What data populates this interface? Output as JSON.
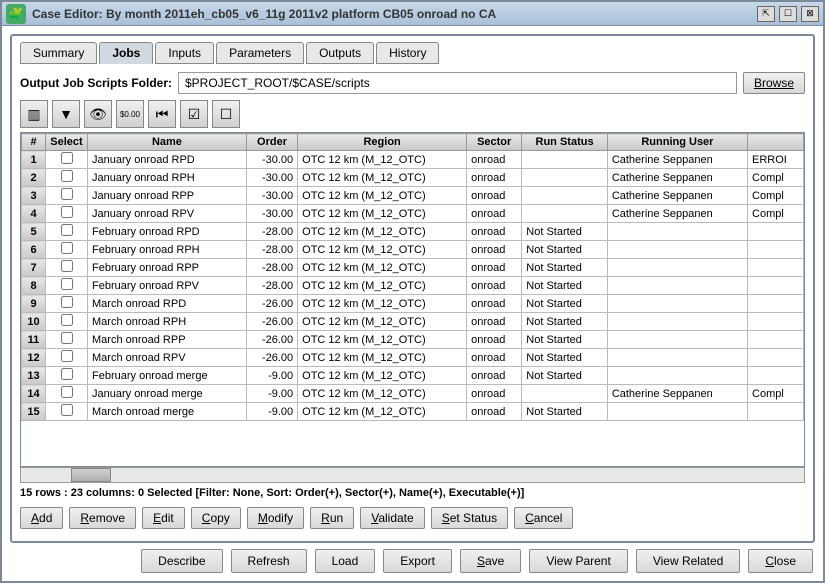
{
  "title": "Case Editor: By month 2011eh_cb05_v6_11g 2011v2 platform CB05 onroad no CA",
  "tabs": [
    "Summary",
    "Jobs",
    "Inputs",
    "Parameters",
    "Outputs",
    "History"
  ],
  "activeTab": 1,
  "folderLabel": "Output Job Scripts Folder:",
  "folderValue": "$PROJECT_ROOT/$CASE/scripts",
  "browseLabel": "Browse",
  "columns": [
    "#",
    "Select",
    "Name",
    "Order",
    "Region",
    "Sector",
    "Run Status",
    "Running User",
    ""
  ],
  "rows": [
    {
      "n": 1,
      "name": "January onroad RPD",
      "order": "-30.00",
      "region": "OTC 12 km (M_12_OTC)",
      "sector": "onroad",
      "status": "",
      "user": "Catherine Seppanen",
      "ext": "ERROI"
    },
    {
      "n": 2,
      "name": "January onroad RPH",
      "order": "-30.00",
      "region": "OTC 12 km (M_12_OTC)",
      "sector": "onroad",
      "status": "",
      "user": "Catherine Seppanen",
      "ext": "Compl"
    },
    {
      "n": 3,
      "name": "January onroad RPP",
      "order": "-30.00",
      "region": "OTC 12 km (M_12_OTC)",
      "sector": "onroad",
      "status": "",
      "user": "Catherine Seppanen",
      "ext": "Compl"
    },
    {
      "n": 4,
      "name": "January onroad RPV",
      "order": "-30.00",
      "region": "OTC 12 km (M_12_OTC)",
      "sector": "onroad",
      "status": "",
      "user": "Catherine Seppanen",
      "ext": "Compl"
    },
    {
      "n": 5,
      "name": "February onroad RPD",
      "order": "-28.00",
      "region": "OTC 12 km (M_12_OTC)",
      "sector": "onroad",
      "status": "Not Started",
      "user": "",
      "ext": ""
    },
    {
      "n": 6,
      "name": "February onroad RPH",
      "order": "-28.00",
      "region": "OTC 12 km (M_12_OTC)",
      "sector": "onroad",
      "status": "Not Started",
      "user": "",
      "ext": ""
    },
    {
      "n": 7,
      "name": "February onroad RPP",
      "order": "-28.00",
      "region": "OTC 12 km (M_12_OTC)",
      "sector": "onroad",
      "status": "Not Started",
      "user": "",
      "ext": ""
    },
    {
      "n": 8,
      "name": "February onroad RPV",
      "order": "-28.00",
      "region": "OTC 12 km (M_12_OTC)",
      "sector": "onroad",
      "status": "Not Started",
      "user": "",
      "ext": ""
    },
    {
      "n": 9,
      "name": "March onroad RPD",
      "order": "-26.00",
      "region": "OTC 12 km (M_12_OTC)",
      "sector": "onroad",
      "status": "Not Started",
      "user": "",
      "ext": ""
    },
    {
      "n": 10,
      "name": "March onroad RPH",
      "order": "-26.00",
      "region": "OTC 12 km (M_12_OTC)",
      "sector": "onroad",
      "status": "Not Started",
      "user": "",
      "ext": ""
    },
    {
      "n": 11,
      "name": "March onroad RPP",
      "order": "-26.00",
      "region": "OTC 12 km (M_12_OTC)",
      "sector": "onroad",
      "status": "Not Started",
      "user": "",
      "ext": ""
    },
    {
      "n": 12,
      "name": "March onroad RPV",
      "order": "-26.00",
      "region": "OTC 12 km (M_12_OTC)",
      "sector": "onroad",
      "status": "Not Started",
      "user": "",
      "ext": ""
    },
    {
      "n": 13,
      "name": "February onroad merge",
      "order": "-9.00",
      "region": "OTC 12 km (M_12_OTC)",
      "sector": "onroad",
      "status": "Not Started",
      "user": "",
      "ext": ""
    },
    {
      "n": 14,
      "name": "January onroad merge",
      "order": "-9.00",
      "region": "OTC 12 km (M_12_OTC)",
      "sector": "onroad",
      "status": "",
      "user": "Catherine Seppanen",
      "ext": "Compl"
    },
    {
      "n": 15,
      "name": "March onroad merge",
      "order": "-9.00",
      "region": "OTC 12 km (M_12_OTC)",
      "sector": "onroad",
      "status": "Not Started",
      "user": "",
      "ext": ""
    }
  ],
  "status": "15 rows : 23 columns: 0 Selected [Filter: None, Sort: Order(+), Sector(+), Name(+), Executable(+)]",
  "actions": [
    "Add",
    "Remove",
    "Edit",
    "Copy",
    "Modify",
    "Run",
    "Validate",
    "Set Status",
    "Cancel"
  ],
  "bottom": [
    "Describe",
    "Refresh",
    "Load",
    "Export",
    "Save",
    "View Parent",
    "View Related",
    "Close"
  ],
  "toolbarIcons": [
    "columns-icon",
    "filter-icon",
    "eye-icon",
    "format-icon",
    "first-icon",
    "check-icon",
    "uncheck-icon"
  ]
}
